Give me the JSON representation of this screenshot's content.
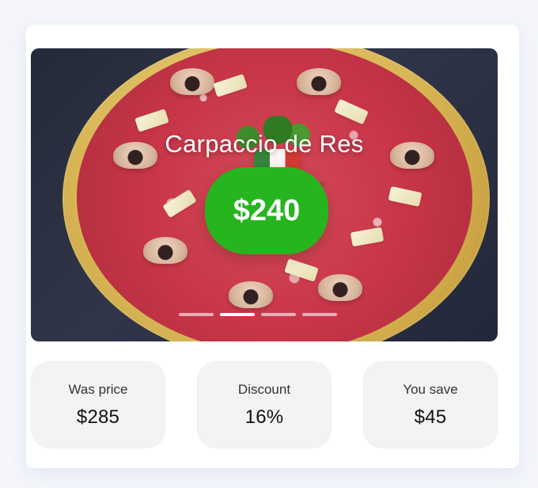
{
  "product": {
    "title": "Carpaccio de Res",
    "price": "$240"
  },
  "carousel": {
    "slides": [
      {
        "active": false
      },
      {
        "active": true
      },
      {
        "active": false
      },
      {
        "active": false
      }
    ]
  },
  "stats": {
    "was_price_label": "Was price",
    "was_price_value": "$285",
    "discount_label": "Discount",
    "discount_value": "16%",
    "you_save_label": "You save",
    "you_save_value": "$45"
  },
  "colors": {
    "price_badge": "#26b51f",
    "card_bg": "#ffffff",
    "stat_card_bg": "#f3f3f3"
  }
}
